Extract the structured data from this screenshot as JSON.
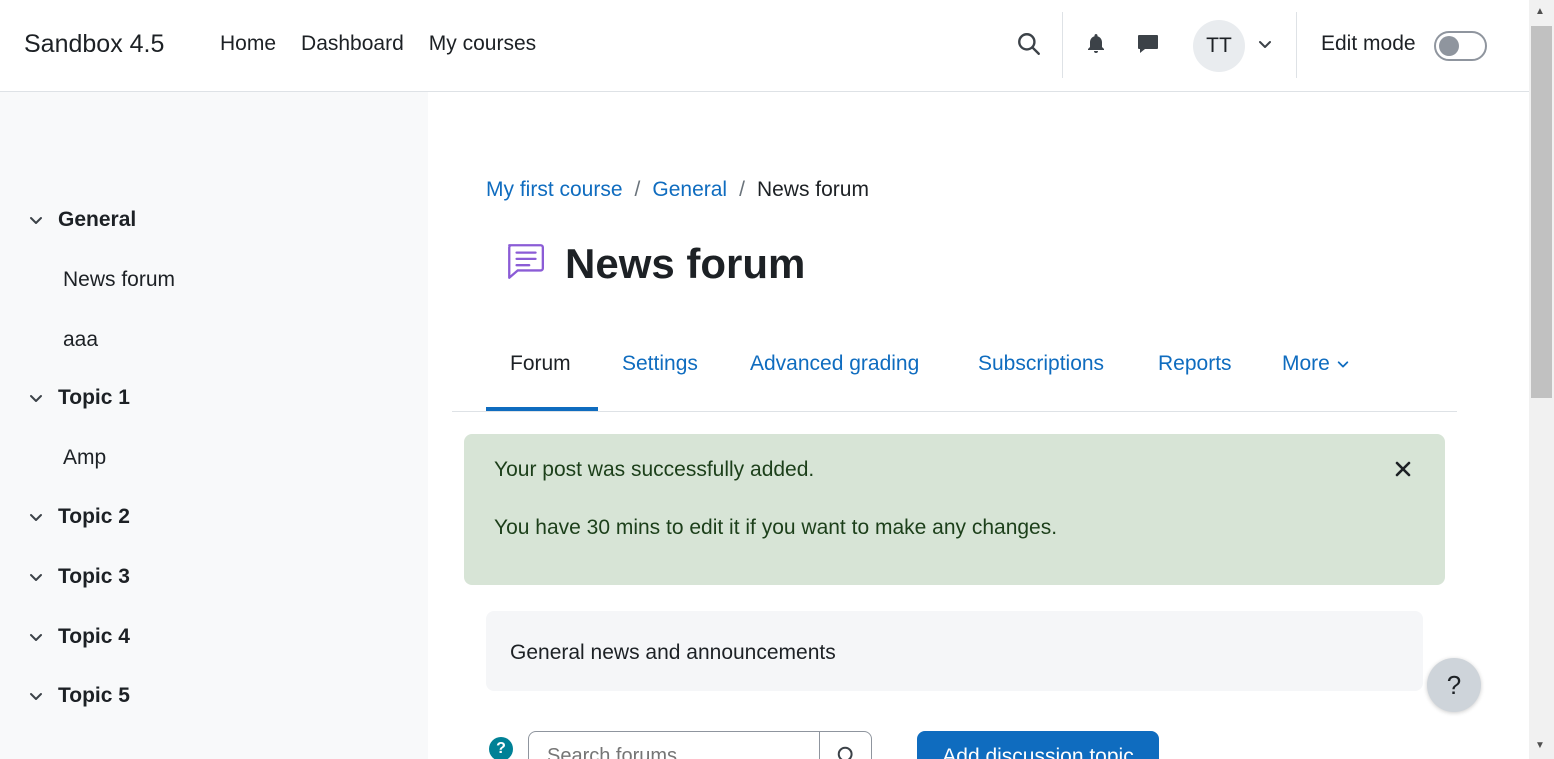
{
  "navbar": {
    "brand": "Sandbox 4.5",
    "links": [
      "Home",
      "Dashboard",
      "My courses"
    ],
    "avatar_initials": "TT",
    "edit_mode_label": "Edit mode",
    "edit_mode_on": false
  },
  "course_index": {
    "sections": [
      {
        "label": "General",
        "items": [
          "News forum",
          "aaa"
        ]
      },
      {
        "label": "Topic 1",
        "items": [
          "Amp"
        ]
      },
      {
        "label": "Topic 2",
        "items": []
      },
      {
        "label": "Topic 3",
        "items": []
      },
      {
        "label": "Topic 4",
        "items": []
      },
      {
        "label": "Topic 5",
        "items": []
      }
    ]
  },
  "breadcrumb": {
    "items": [
      "My first course",
      "General"
    ],
    "current": "News forum",
    "separator": "/"
  },
  "page": {
    "title": "News forum",
    "icon": "forum-icon"
  },
  "tabs": {
    "items": [
      "Forum",
      "Settings",
      "Advanced grading",
      "Subscriptions",
      "Reports",
      "More"
    ],
    "active": "Forum"
  },
  "alert": {
    "line1": "Your post was successfully added.",
    "line2": "You have 30 mins to edit it if you want to make any changes."
  },
  "intro": {
    "text": "General news and announcements"
  },
  "search": {
    "placeholder": "Search forums"
  },
  "actions": {
    "add_topic_label": "Add discussion topic",
    "help_fab": "?",
    "help_small": "?"
  },
  "colors": {
    "link": "#0f6cbf",
    "alert_bg": "#d7e4d6",
    "drawer_bg": "#f8f9fa",
    "forum_icon": "#8b5cd6"
  }
}
